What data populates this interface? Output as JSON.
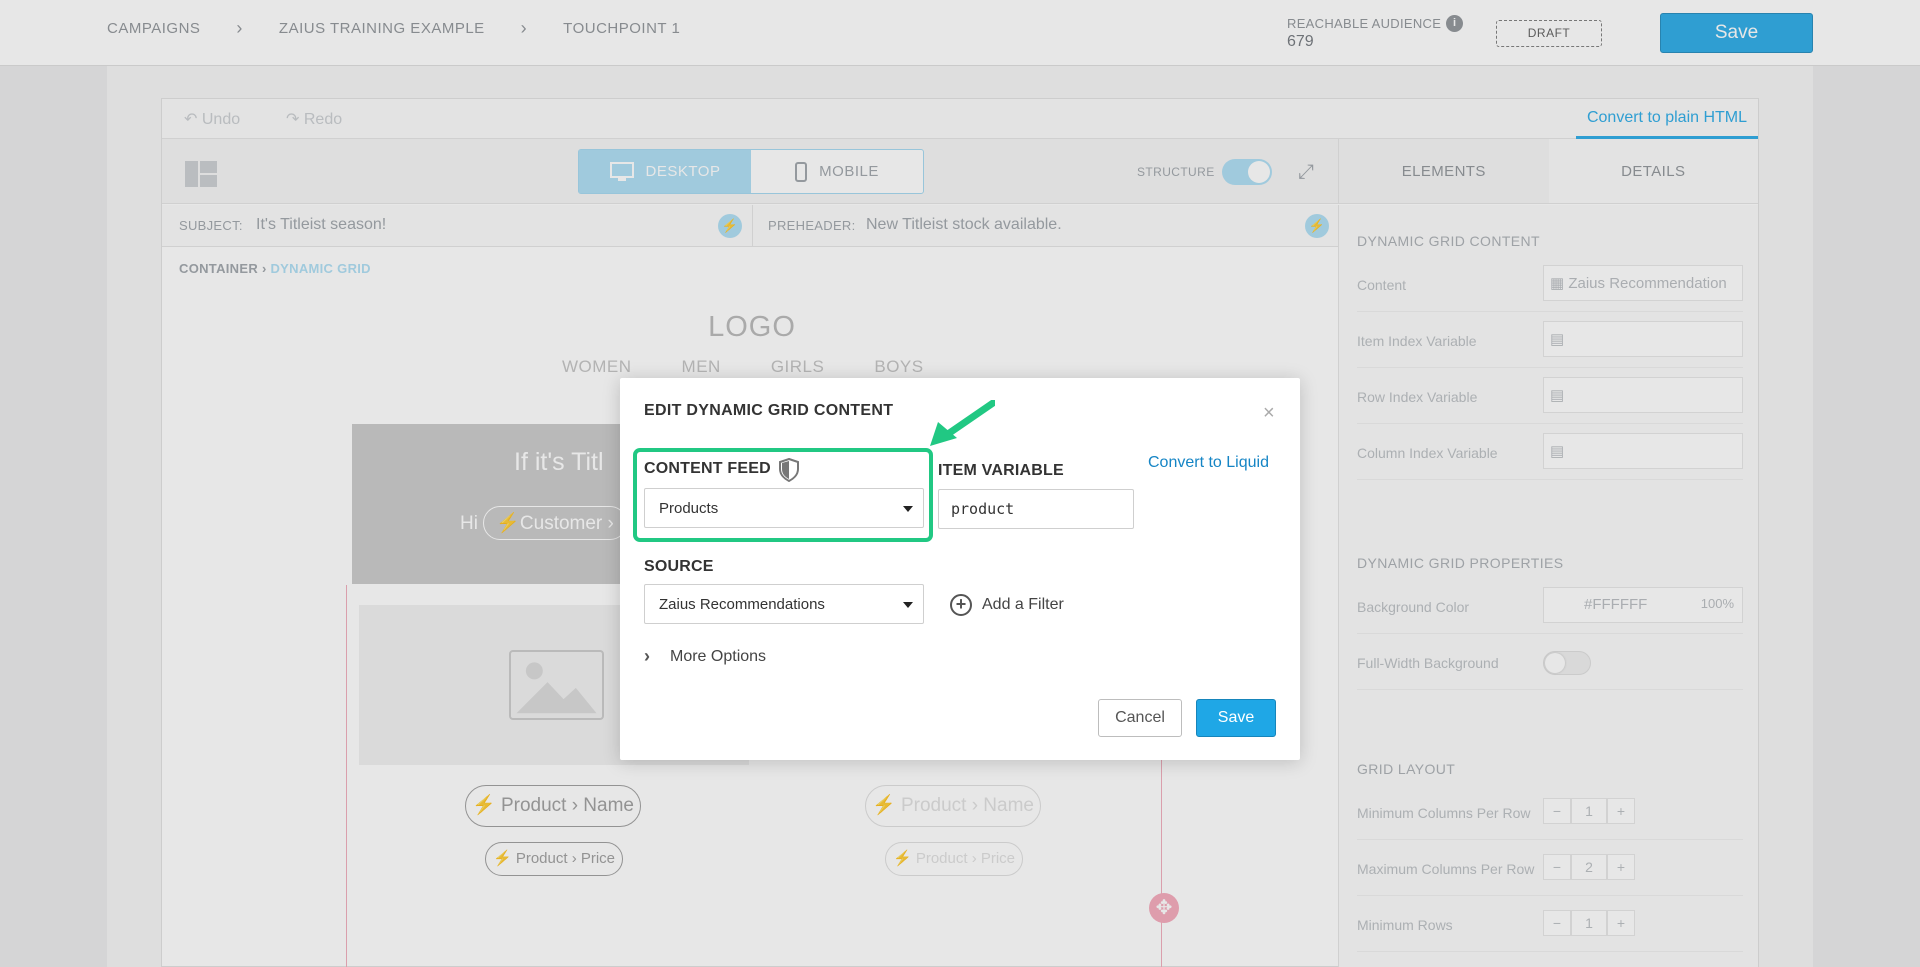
{
  "header": {
    "breadcrumbs": [
      "CAMPAIGNS",
      "ZAIUS TRAINING EXAMPLE",
      "TOUCHPOINT 1"
    ],
    "reachable_audience_label": "REACHABLE AUDIENCE",
    "reachable_audience_count": "679",
    "status_badge": "DRAFT",
    "save_label": "Save"
  },
  "toolbar": {
    "undo_label": "Undo",
    "redo_label": "Redo",
    "convert_html_label": "Convert to plain HTML",
    "desktop_label": "DESKTOP",
    "mobile_label": "MOBILE",
    "structure_label": "STRUCTURE",
    "tabs": [
      "ELEMENTS",
      "DETAILS"
    ]
  },
  "email_meta": {
    "subject_label": "SUBJECT:",
    "subject_value": "It's Titleist season!",
    "preheader_label": "PREHEADER:",
    "preheader_value": "New Titleist stock available."
  },
  "canvas_breadcrumb": {
    "parent": "CONTAINER",
    "current": "DYNAMIC GRID"
  },
  "email_preview": {
    "logo": "LOGO",
    "nav": [
      "WOMEN",
      "MEN",
      "GIRLS",
      "BOYS"
    ],
    "hero_heading": "If it's Titl",
    "hero_greeting": "Hi",
    "hero_token": "Customer ›",
    "product_name_token": "Product › Name",
    "product_price_token": "Product › Price"
  },
  "details_panel": {
    "section1_title": "DYNAMIC GRID CONTENT",
    "content_label": "Content",
    "content_value": "Zaius Recommendation",
    "item_index_label": "Item Index Variable",
    "row_index_label": "Row Index Variable",
    "column_index_label": "Column Index Variable",
    "section2_title": "DYNAMIC GRID PROPERTIES",
    "bg_color_label": "Background Color",
    "bg_color_value": "#FFFFFF",
    "bg_opacity_value": "100%",
    "full_width_label": "Full-Width Background",
    "section3_title": "GRID LAYOUT",
    "min_cols_label": "Minimum Columns Per Row",
    "min_cols_value": "1",
    "max_cols_label": "Maximum Columns Per Row",
    "max_cols_value": "2",
    "min_rows_label": "Minimum Rows",
    "min_rows_value": "1",
    "stepper_minus": "−",
    "stepper_plus": "+"
  },
  "modal": {
    "title": "EDIT DYNAMIC GRID CONTENT",
    "close_glyph": "×",
    "content_feed_label": "CONTENT FEED",
    "content_feed_value": "Products",
    "item_variable_label": "ITEM VARIABLE",
    "item_variable_value": "product",
    "convert_liquid_label": "Convert to Liquid",
    "source_label": "SOURCE",
    "source_value": "Zaius Recommendations",
    "add_filter_label": "Add a Filter",
    "more_options_label": "More Options",
    "cancel_label": "Cancel",
    "save_label": "Save"
  },
  "colors": {
    "primary_blue": "#1fa7e6",
    "highlight_green": "#21c883",
    "link_blue": "#1585c5"
  }
}
